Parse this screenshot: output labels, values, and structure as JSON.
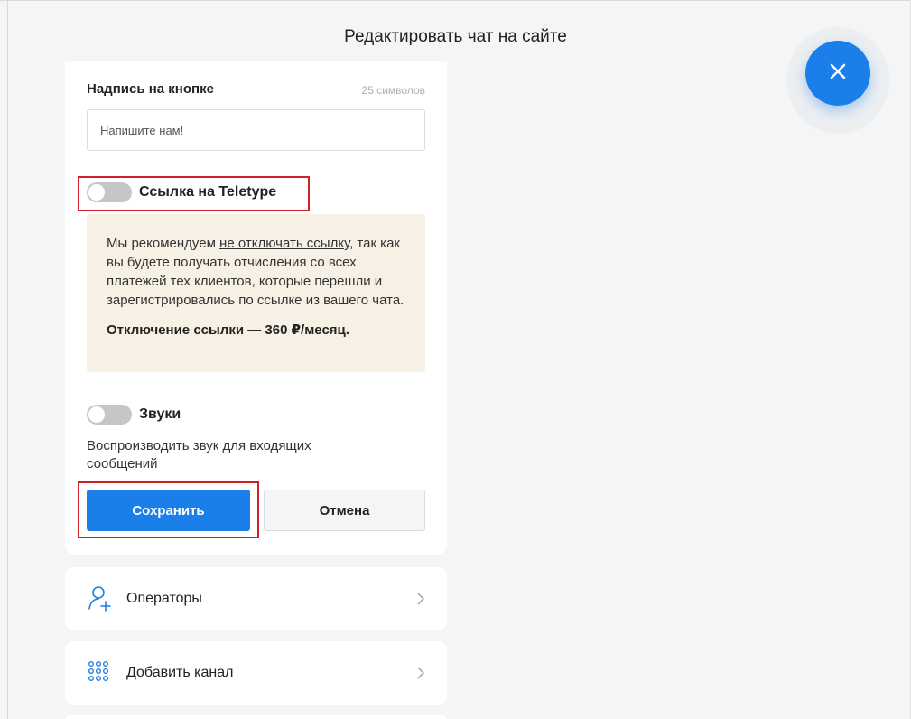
{
  "header": {
    "title": "Редактировать чат на сайте"
  },
  "button_text_field": {
    "label": "Надпись на кнопке",
    "counter": "25 символов",
    "value": "Напишите нам!"
  },
  "teletype_link": {
    "label": "Ссылка на Teletype",
    "enabled": false
  },
  "notice": {
    "text_before": "Мы рекомендуем ",
    "link": "не отключать ссылку",
    "text_after": ", так как вы будете получать отчисления со всех платежей тех клиентов, которые перешли и зарегистрировались по ссылке из вашего чата.",
    "price": "Отключение ссылки — 360 ₽/месяц."
  },
  "sounds": {
    "label": "Звуки",
    "enabled": false,
    "description": "Воспроизводить звук для входящих сообщений"
  },
  "actions": {
    "save": "Сохранить",
    "cancel": "Отмена"
  },
  "nav": [
    {
      "label": "Операторы",
      "icon": "add-user-icon"
    },
    {
      "label": "Добавить канал",
      "icon": "grid-dots-icon"
    }
  ],
  "colors": {
    "accent": "#1a7fe8",
    "notice_bg": "#f6f0e5",
    "highlight": "#d0202a",
    "toggle_off": "#c6c6c6"
  }
}
